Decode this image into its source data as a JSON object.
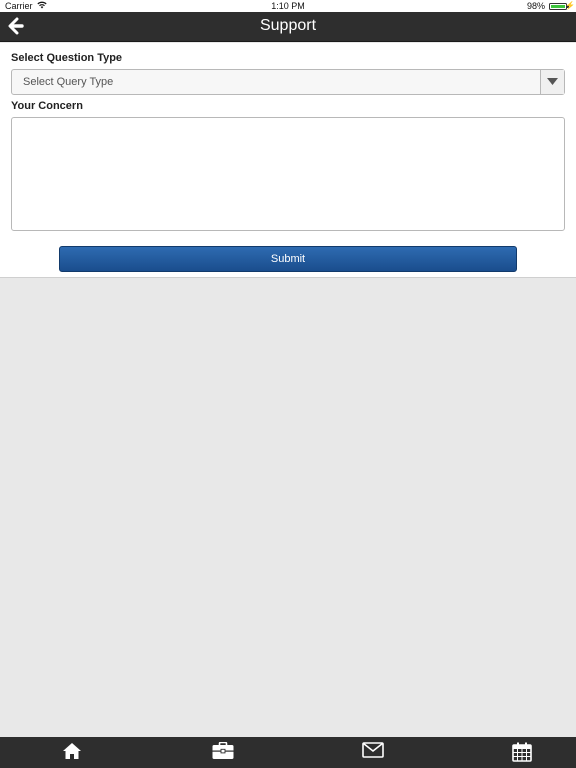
{
  "status_bar": {
    "carrier": "Carrier",
    "time": "1:10 PM",
    "battery": "98%",
    "battery_level": 0.98
  },
  "nav": {
    "title": "Support",
    "back_icon": "arrow-left-icon"
  },
  "form": {
    "question_type_label": "Select Question Type",
    "question_type_placeholder": "Select Query Type",
    "concern_label": "Your Concern",
    "concern_value": "",
    "submit_label": "Submit"
  },
  "tabs": [
    {
      "name": "home",
      "icon": "home-icon"
    },
    {
      "name": "briefcase",
      "icon": "briefcase-icon"
    },
    {
      "name": "mail",
      "icon": "mail-icon"
    },
    {
      "name": "calendar",
      "icon": "calendar-icon"
    }
  ],
  "colors": {
    "nav_bg": "#2e2e2e",
    "button_blue": "#1f5799",
    "background": "#e8e8e8",
    "battery_green": "#3ec43e"
  }
}
